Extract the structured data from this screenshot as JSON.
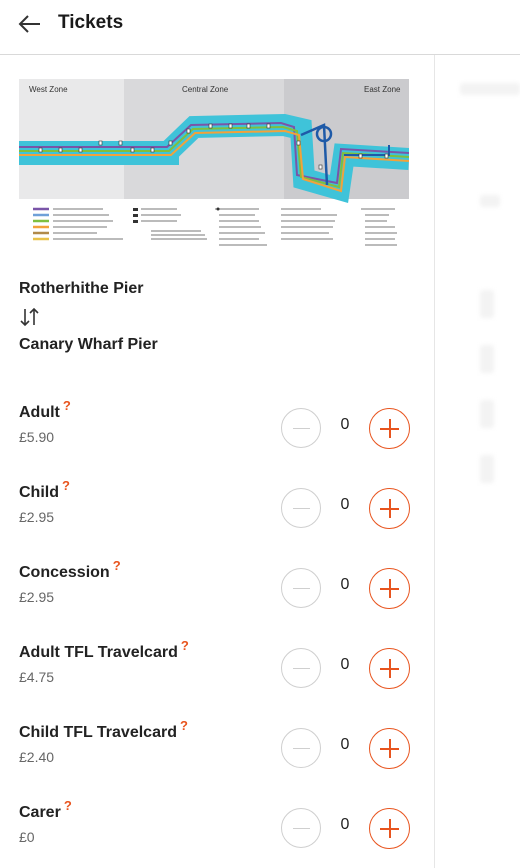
{
  "header": {
    "title": "Tickets"
  },
  "map": {
    "zones": [
      "West Zone",
      "Central Zone",
      "East Zone"
    ],
    "colors": {
      "river": "#3fc3d9",
      "west_bg": "#e9e9ea",
      "central_bg": "#d9d9db",
      "east_bg": "#cbcbce",
      "route": "#1e5aa8",
      "line_green": "#7fbf3f",
      "line_orange": "#f2a23a",
      "line_purple": "#7a55a8"
    }
  },
  "route": {
    "from": "Rotherhithe Pier",
    "to": "Canary Wharf Pier"
  },
  "tickets": [
    {
      "name": "Adult",
      "help": "?",
      "price": "£5.90",
      "qty": "0"
    },
    {
      "name": "Child",
      "help": "?",
      "price": "£2.95",
      "qty": "0"
    },
    {
      "name": "Concession",
      "help": "?",
      "price": "£2.95",
      "qty": "0"
    },
    {
      "name": "Adult TFL Travelcard",
      "help": "?",
      "price": "£4.75",
      "qty": "0"
    },
    {
      "name": "Child TFL Travelcard",
      "help": "?",
      "price": "£2.40",
      "qty": "0"
    },
    {
      "name": "Carer",
      "help": "?",
      "price": "£0",
      "qty": "0"
    }
  ],
  "colors": {
    "accent": "#e8541e",
    "disabled": "#cfcfcf"
  }
}
